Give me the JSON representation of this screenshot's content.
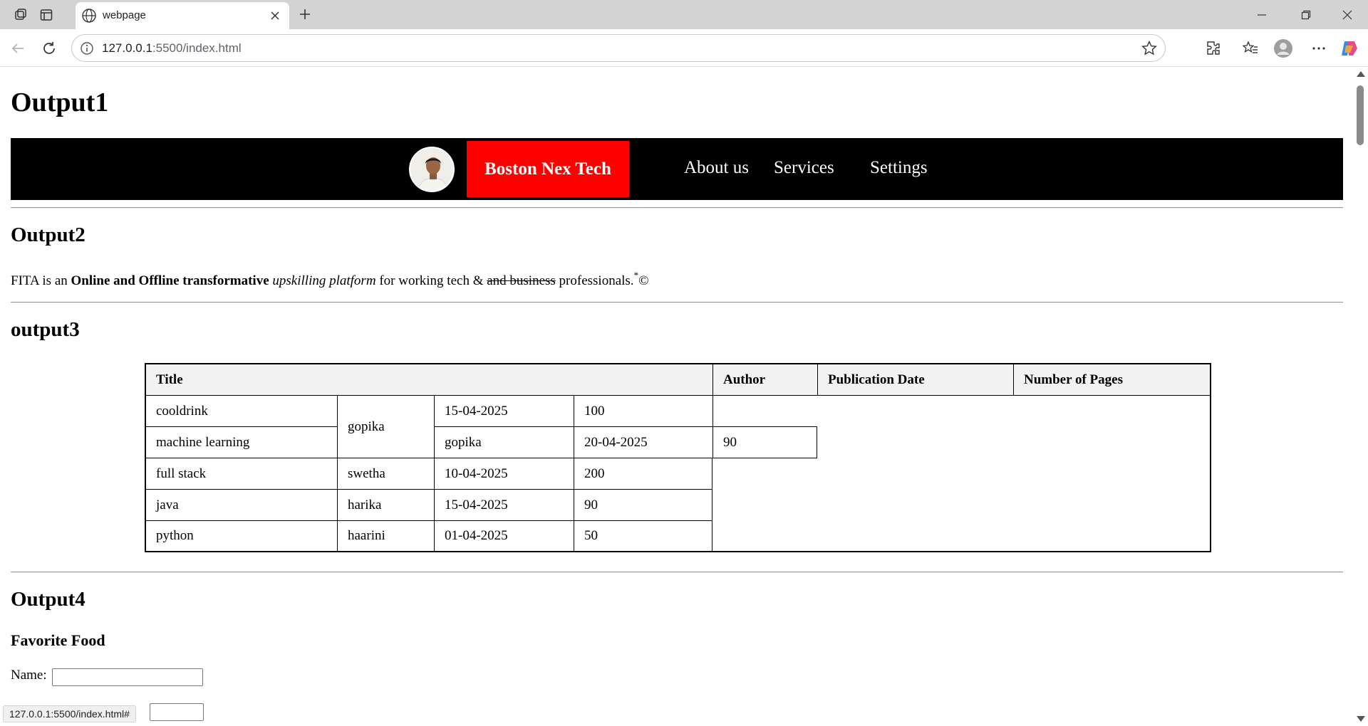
{
  "browser": {
    "tab_title": "webpage",
    "url_host": "127.0.0.1",
    "url_rest": ":5500/index.html",
    "status_url": "127.0.0.1:5500/index.html#"
  },
  "page": {
    "output1_heading": "Output1",
    "navbar": {
      "brand": "Boston Nex Tech",
      "links": [
        "About us",
        "Services",
        "Settings"
      ],
      "brand_bg": "#ff0000",
      "bar_bg": "#000000"
    },
    "output2_heading": "Output2",
    "paragraph": {
      "p1": "FITA is an ",
      "bold": "Online and Offline transformative",
      "p2": " ",
      "italic": "upskilling platform",
      "p3": " for working tech & ",
      "strike": "and business",
      "p4": " professionals.",
      "sup": "*",
      "p5": "©"
    },
    "output3_heading": "output3",
    "table": {
      "headers": [
        "Title",
        "Author",
        "Publication Date",
        "Number of Pages"
      ],
      "rows": [
        [
          "cooldrink",
          "gopika",
          "15-04-2025",
          "100"
        ],
        [
          "machine learning",
          "gopika",
          "20-04-2025",
          "90"
        ],
        [
          "full stack",
          "swetha",
          "10-04-2025",
          "200"
        ],
        [
          "java",
          "harika",
          "15-04-2025",
          "90"
        ],
        [
          "python",
          "haarini",
          "01-04-2025",
          "50"
        ]
      ]
    },
    "output4_heading": "Output4",
    "form_heading": "Favorite Food",
    "name_label": "Name:"
  }
}
